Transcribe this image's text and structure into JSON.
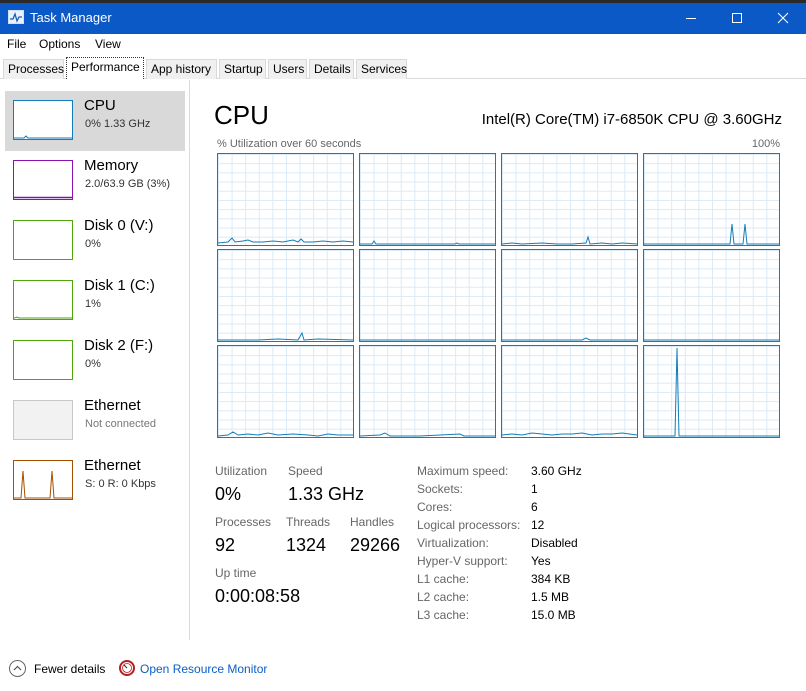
{
  "window": {
    "title": "Task Manager",
    "controls": [
      "minimize-icon",
      "maximize-icon",
      "close-icon"
    ]
  },
  "menu": [
    "File",
    "Options",
    "View"
  ],
  "tabs": [
    {
      "label": "Processes"
    },
    {
      "label": "Performance",
      "active": true
    },
    {
      "label": "App history"
    },
    {
      "label": "Startup"
    },
    {
      "label": "Users"
    },
    {
      "label": "Details"
    },
    {
      "label": "Services"
    }
  ],
  "sidebar": {
    "items": [
      {
        "name": "CPU",
        "sub": "0% 1.33 GHz",
        "color": "#117dbb",
        "selected": true
      },
      {
        "name": "Memory",
        "sub": "2.0/63.9 GB (3%)",
        "color": "#8b12ae"
      },
      {
        "name": "Disk 0 (V:)",
        "sub": "0%",
        "color": "#4da60c"
      },
      {
        "name": "Disk 1 (C:)",
        "sub": "1%",
        "color": "#4da60c"
      },
      {
        "name": "Disk 2 (F:)",
        "sub": "0%",
        "color": "#4da60c"
      },
      {
        "name": "Ethernet",
        "sub": "Not connected",
        "color": "#a7a7a7"
      },
      {
        "name": "Ethernet",
        "sub": "S: 0 R: 0 Kbps",
        "color": "#a74f01"
      }
    ]
  },
  "main": {
    "title": "CPU",
    "model": "Intel(R) Core(TM) i7-6850K CPU @ 3.60GHz",
    "graph_caption": "% Utilization over 60 seconds",
    "graph_max": "100%",
    "core_count": 12
  },
  "stats": {
    "utilization_label": "Utilization",
    "utilization": "0%",
    "speed_label": "Speed",
    "speed": "1.33 GHz",
    "processes_label": "Processes",
    "processes": "92",
    "threads_label": "Threads",
    "threads": "1324",
    "handles_label": "Handles",
    "handles": "29266",
    "uptime_label": "Up time",
    "uptime": "0:00:08:58"
  },
  "details": [
    {
      "label": "Maximum speed:",
      "value": "3.60 GHz"
    },
    {
      "label": "Sockets:",
      "value": "1"
    },
    {
      "label": "Cores:",
      "value": "6"
    },
    {
      "label": "Logical processors:",
      "value": "12"
    },
    {
      "label": "Virtualization:",
      "value": "Disabled"
    },
    {
      "label": "Hyper-V support:",
      "value": "Yes"
    },
    {
      "label": "L1 cache:",
      "value": "384 KB"
    },
    {
      "label": "L2 cache:",
      "value": "1.5 MB"
    },
    {
      "label": "L3 cache:",
      "value": "15.0 MB"
    }
  ],
  "footer": {
    "fewer_details": "Fewer details",
    "resource_monitor": "Open Resource Monitor"
  },
  "colors": {
    "titlebar": "#0b58c7",
    "cpu_graph": "#117dbb",
    "memory": "#8b12ae",
    "disk": "#4da60c",
    "ethernet": "#a74f01",
    "link": "#0a5ec6"
  }
}
